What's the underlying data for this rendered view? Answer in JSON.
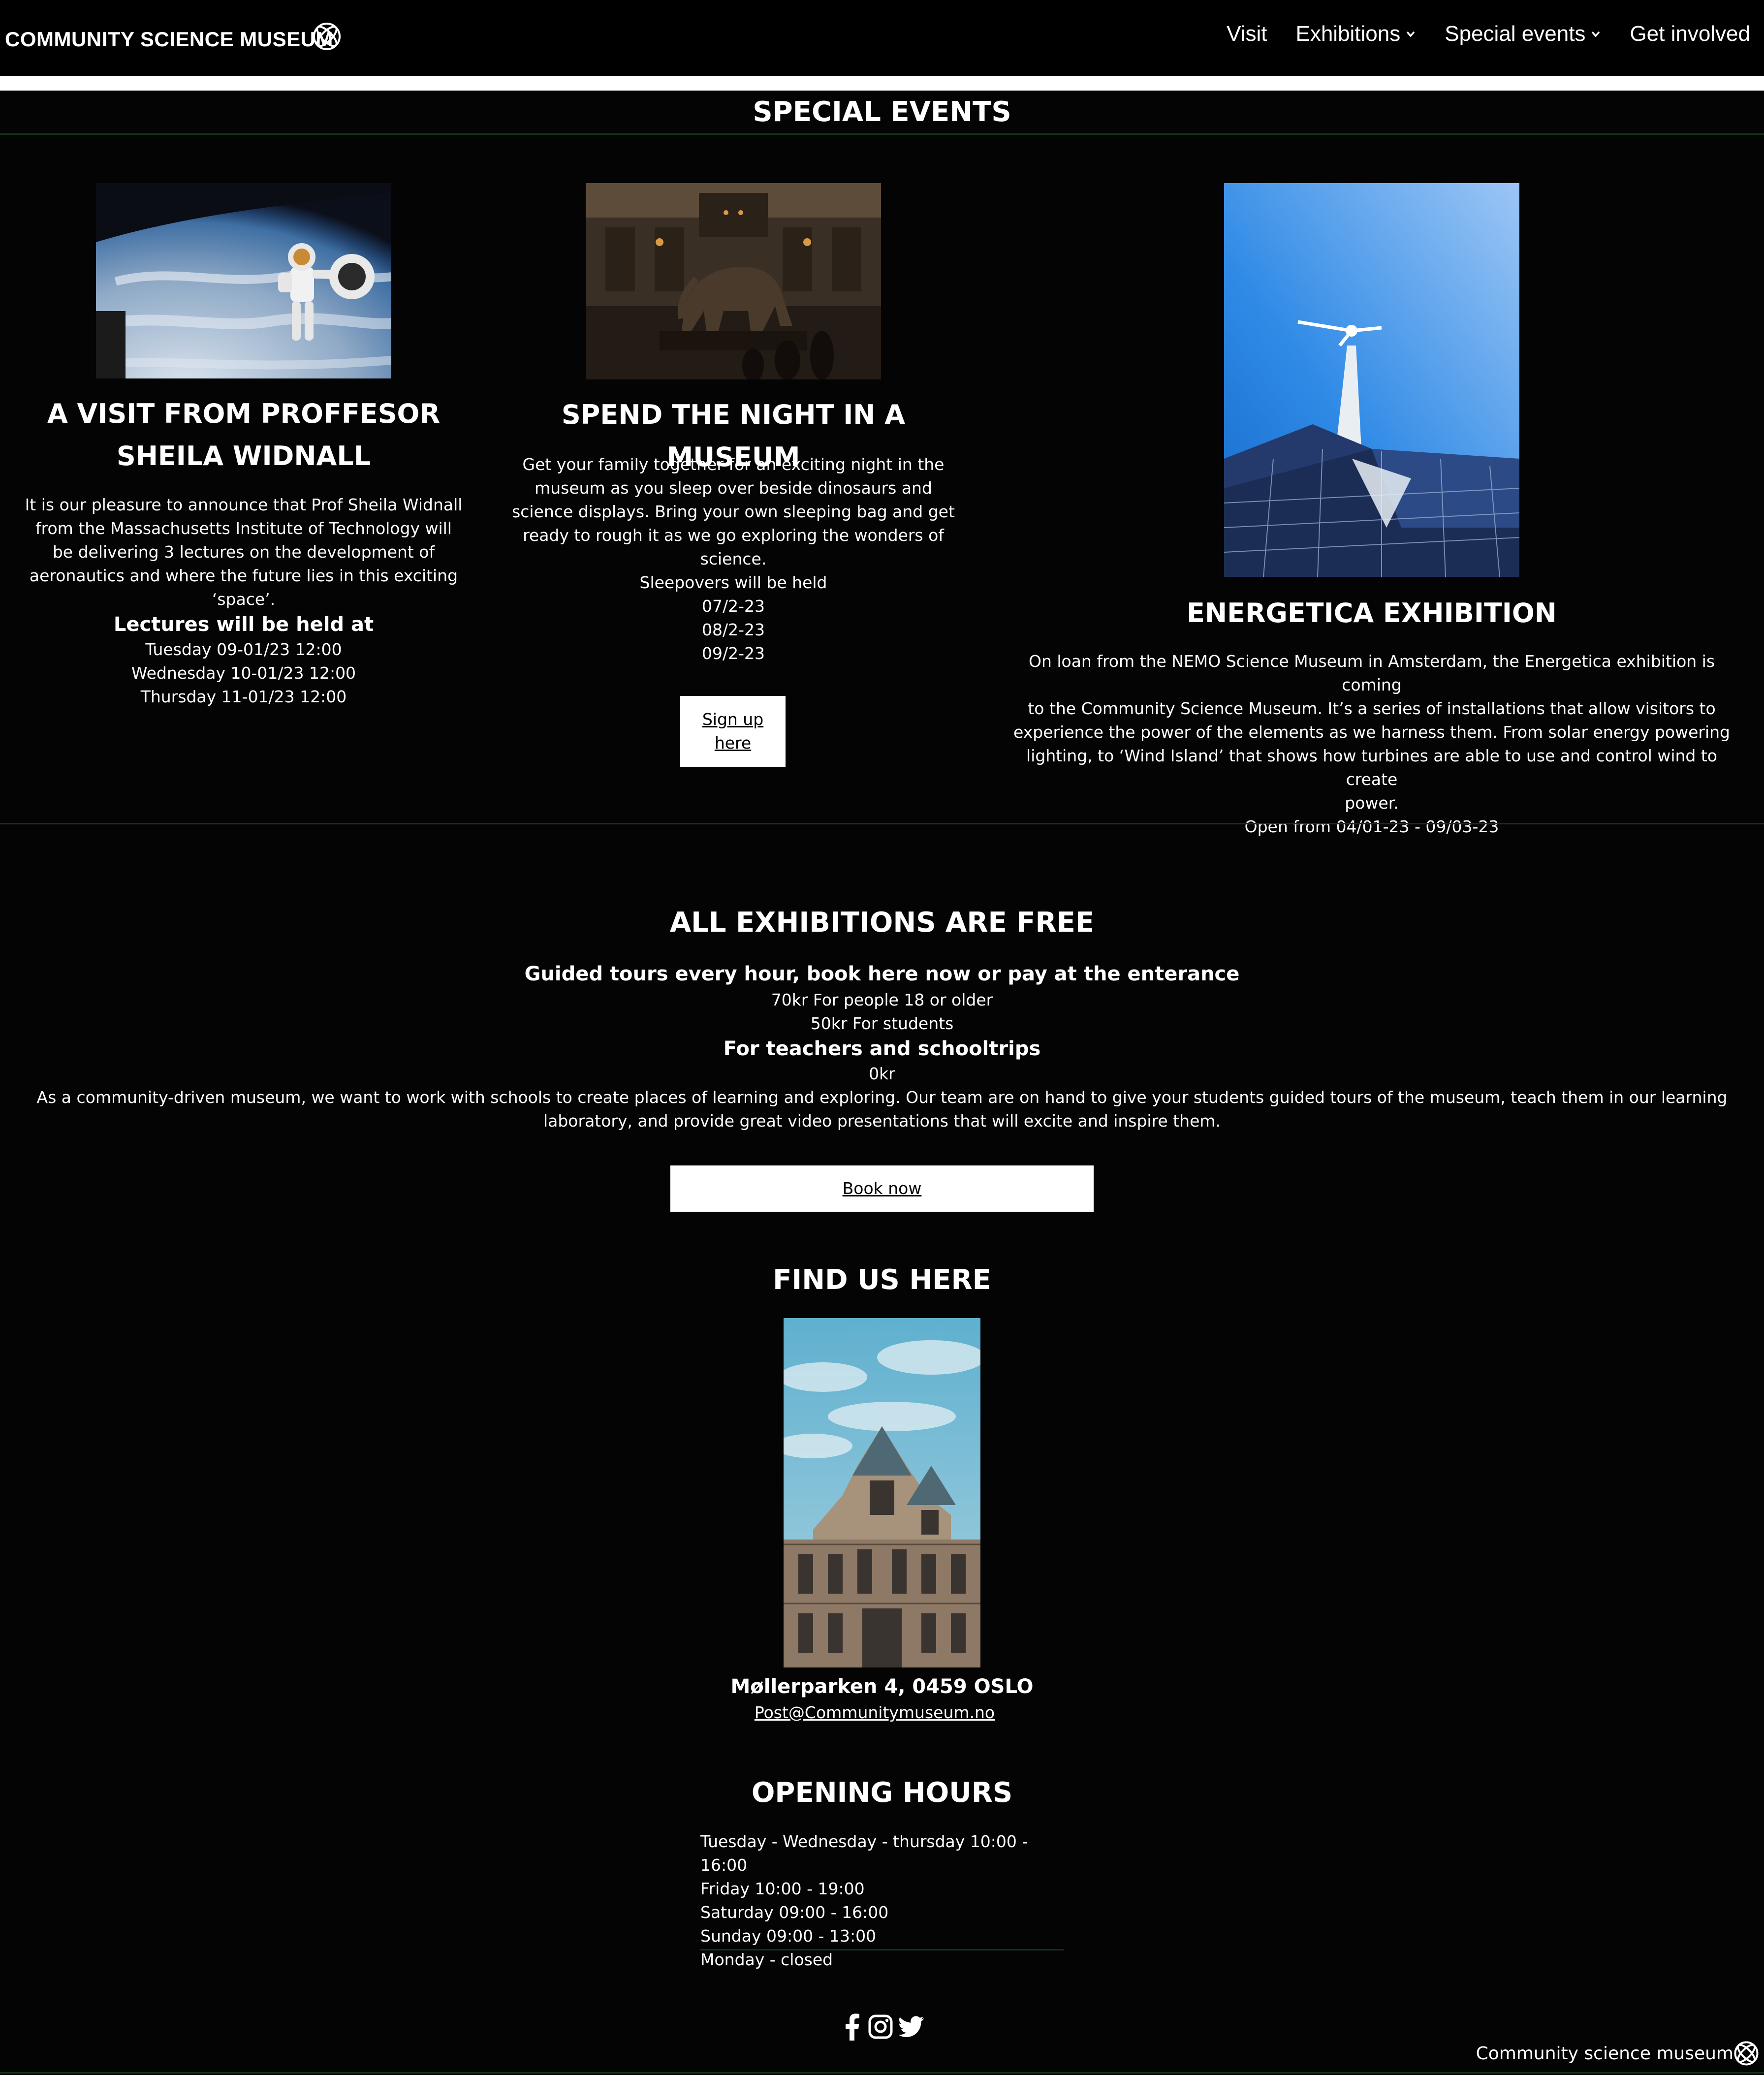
{
  "header": {
    "brand": "COMMUNITY SCIENCE MUSEUM",
    "nav": [
      "Visit",
      "Exhibitions",
      "Special events",
      "Get involved"
    ]
  },
  "special_events": {
    "title": "SPECIAL EVENTS",
    "event1": {
      "title_line1": "A VISIT FROM PROFFESOR",
      "title_line2": "SHEILA WIDNALL",
      "desc": [
        "It is our pleasure to announce that Prof Sheila Widnall",
        "from the Massachusetts Institute of Technology will",
        "be delivering 3 lectures on the development of",
        "aeronautics and where the future lies in this exciting",
        "‘space’."
      ],
      "sub": "Lectures will be held at",
      "dates": [
        "Tuesday 09-01/23 12:00",
        "Wednesday 10-01/23 12:00",
        "Thursday 11-01/23 12:00"
      ]
    },
    "event2": {
      "title": "SPEND THE NIGHT IN A MUSEUM",
      "desc": [
        "Get your family together for an exciting night in the",
        "museum as you sleep over beside dinosaurs and",
        "science displays. Bring your own sleeping bag and get",
        "ready to rough it as we go exploring the wonders of",
        "science."
      ],
      "held": "Sleepovers will be held",
      "dates": [
        "07/2-23",
        "08/2-23",
        "09/2-23"
      ],
      "button_line1": "Sign up",
      "button_line2": "here"
    },
    "event3": {
      "title": "ENERGETICA EXHIBITION",
      "desc": [
        "On loan from the NEMO Science Museum in Amsterdam, the Energetica exhibition is coming",
        "to the Community Science Museum. It’s a series of installations that allow visitors to",
        "experience the power of the elements as we harness them. From solar energy powering",
        "lighting, to ‘Wind Island’ that shows how turbines are able to use and control wind to create",
        "power."
      ],
      "open": "Open from 04/01-23 - 09/03-23"
    }
  },
  "exhibitions": {
    "title": "ALL EXHIBITIONS ARE FREE",
    "tours_heading": "Guided tours every hour, book here now or pay at the enterance",
    "price_adult": "70kr For people 18 or older",
    "price_student": "50kr For students",
    "teachers_heading": "For teachers and schooltrips",
    "price_teachers": "0kr",
    "desc_line1": "As a community-driven museum, we want to work with schools to create places of learning and exploring. Our team are on hand to give your students guided tours of the museum, teach them in our learning",
    "desc_line2": "laboratory, and provide great video presentations that will excite and inspire them.",
    "button": "Book now"
  },
  "find_us": {
    "title": "FIND US HERE",
    "address": "Møllerparken 4, 0459 OSLO",
    "email": "Post@Communitymuseum.no"
  },
  "opening_hours": {
    "title": "OPENING HOURS",
    "lines": [
      "Tuesday - Wednesday - thursday 10:00 - 16:00",
      "Friday 10:00 - 19:00",
      "Saturday 09:00 - 16:00",
      "Sunday 09:00 - 13:00",
      "Monday - closed"
    ]
  },
  "social": [
    "facebook-icon",
    "instagram-icon",
    "twitter-icon"
  ],
  "footer": {
    "text": "Community science museum"
  },
  "colors": {
    "background": "#040404",
    "divider": "#12331a",
    "button_bg": "#ffffff"
  }
}
